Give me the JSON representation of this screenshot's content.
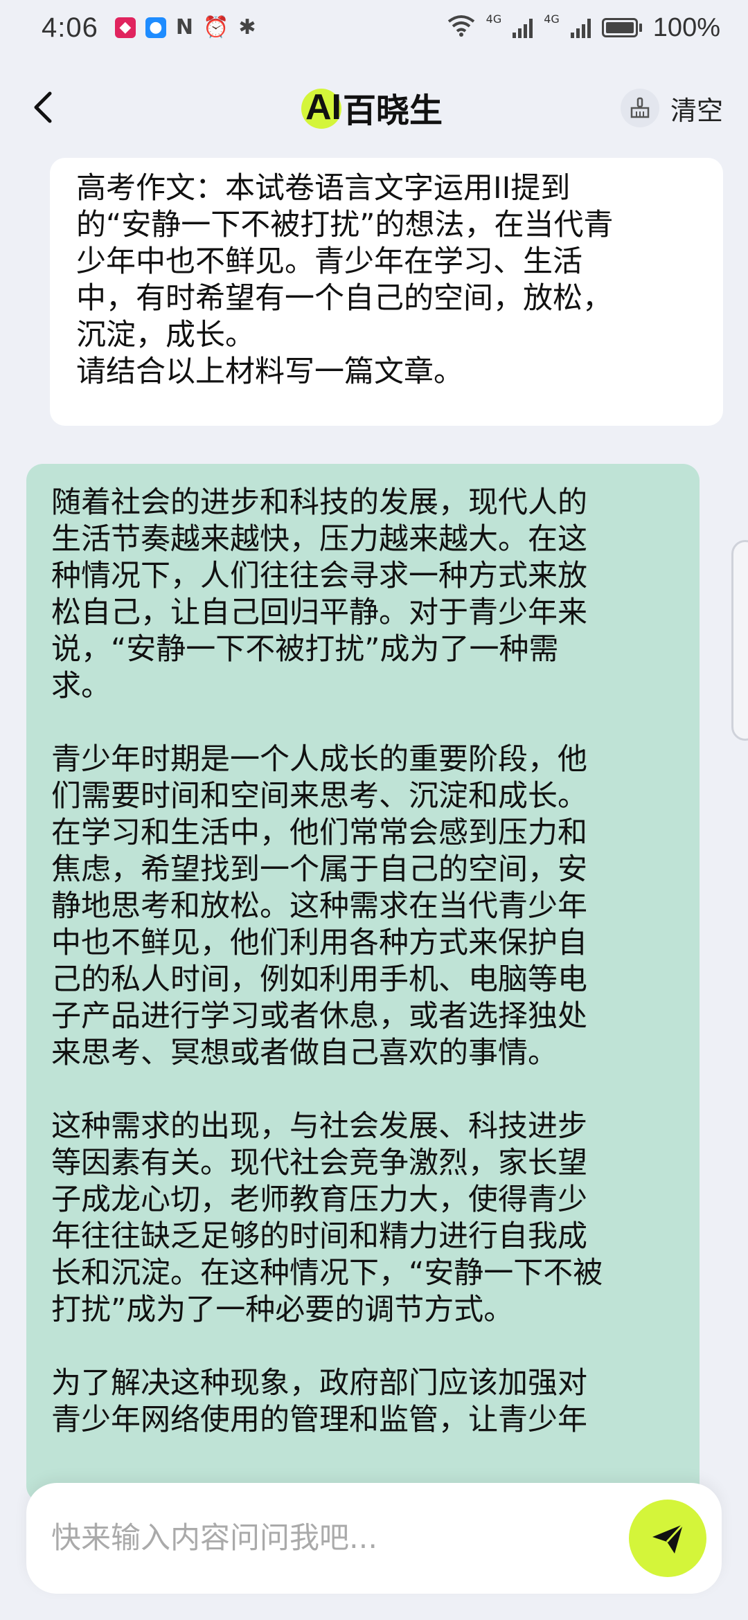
{
  "status_bar": {
    "time": "4:06",
    "network_label_1": "4G",
    "network_label_2": "4G",
    "battery": "100%"
  },
  "header": {
    "back_icon": "chevron-left-icon",
    "logo_ai": "AI",
    "logo_name": "百晓生",
    "clear_label": "清空",
    "clear_icon": "broom-icon",
    "accent_color": "#d4f53a"
  },
  "messages": {
    "user": "高考作文：本试卷语言文字运用II提到\n的“安静一下不被打扰”的想法，在当代青\n少年中也不鲜见。青少年在学习、生活\n中，有时希望有一个自己的空间，放松，\n沉淀，成长。\n请结合以上材料写一篇文章。",
    "ai_paragraphs": [
      "随着社会的进步和科技的发展，现代人的\n生活节奏越来越快，压力越来越大。在这\n种情况下，人们往往会寻求一种方式来放\n松自己，让自己回归平静。对于青少年来\n说，“安静一下不被打扰”成为了一种需\n求。",
      "青少年时期是一个人成长的重要阶段，他\n们需要时间和空间来思考、沉淀和成长。\n在学习和生活中，他们常常会感到压力和\n焦虑，希望找到一个属于自己的空间，安\n静地思考和放松。这种需求在当代青少年\n中也不鲜见，他们利用各种方式来保护自\n己的私人时间，例如利用手机、电脑等电\n子产品进行学习或者休息，或者选择独处\n来思考、冥想或者做自己喜欢的事情。",
      "这种需求的出现，与社会发展、科技进步\n等因素有关。现代社会竞争激烈，家长望\n子成龙心切，老师教育压力大，使得青少\n年往往缺乏足够的时间和精力进行自我成\n长和沉淀。在这种情况下，“安静一下不被\n打扰”成为了一种必要的调节方式。",
      "为了解决这种现象，政府部门应该加强对\n青少年网络使用的管理和监管，让青少年"
    ],
    "ai_bubble_color": "#bfe3d6"
  },
  "input": {
    "placeholder": "快来输入内容问问我吧...",
    "value": "",
    "send_icon": "paper-plane-icon"
  }
}
